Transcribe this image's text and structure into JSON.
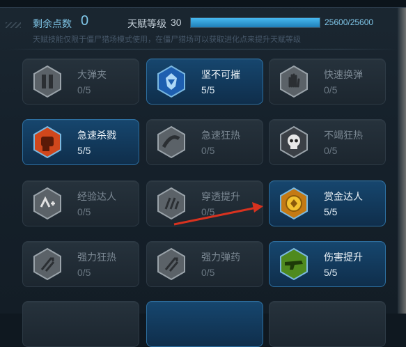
{
  "header": {
    "points_label": "剩余点数",
    "points_value": "0",
    "level_label": "天赋等级",
    "level_value": "30",
    "exp_text": "25600/25600",
    "exp_progress": 1.0,
    "note": "天赋技能仅限于僵尸猎场模式使用，在僵尸猎场可以获取进化点来提升天赋等级"
  },
  "talents": [
    {
      "name": "大弹夹",
      "level": "0/5",
      "active": false,
      "icon": "magazine-icon"
    },
    {
      "name": "坚不可摧",
      "level": "5/5",
      "active": true,
      "icon": "shield-icon"
    },
    {
      "name": "快速换弹",
      "level": "0/5",
      "active": false,
      "icon": "hand-icon"
    },
    {
      "name": "急速杀戮",
      "level": "5/5",
      "active": true,
      "icon": "fist-icon"
    },
    {
      "name": "急速狂热",
      "level": "0/5",
      "active": false,
      "icon": "ammo-belt-icon"
    },
    {
      "name": "不竭狂热",
      "level": "0/5",
      "active": false,
      "icon": "skull-icon"
    },
    {
      "name": "经验达人",
      "level": "0/5",
      "active": false,
      "icon": "exp-plus-icon"
    },
    {
      "name": "穿透提升",
      "level": "0/5",
      "active": false,
      "icon": "pierce-icon"
    },
    {
      "name": "赏金达人",
      "level": "5/5",
      "active": true,
      "icon": "coin-icon"
    },
    {
      "name": "强力狂热",
      "level": "0/5",
      "active": false,
      "icon": "power-fever-icon"
    },
    {
      "name": "强力弹药",
      "level": "0/5",
      "active": false,
      "icon": "power-ammo-icon"
    },
    {
      "name": "伤害提升",
      "level": "5/5",
      "active": true,
      "icon": "gun-icon"
    }
  ],
  "colors": {
    "accent": "#7fc6e8",
    "active_card": "#16466e",
    "arrow": "#d8321f"
  }
}
